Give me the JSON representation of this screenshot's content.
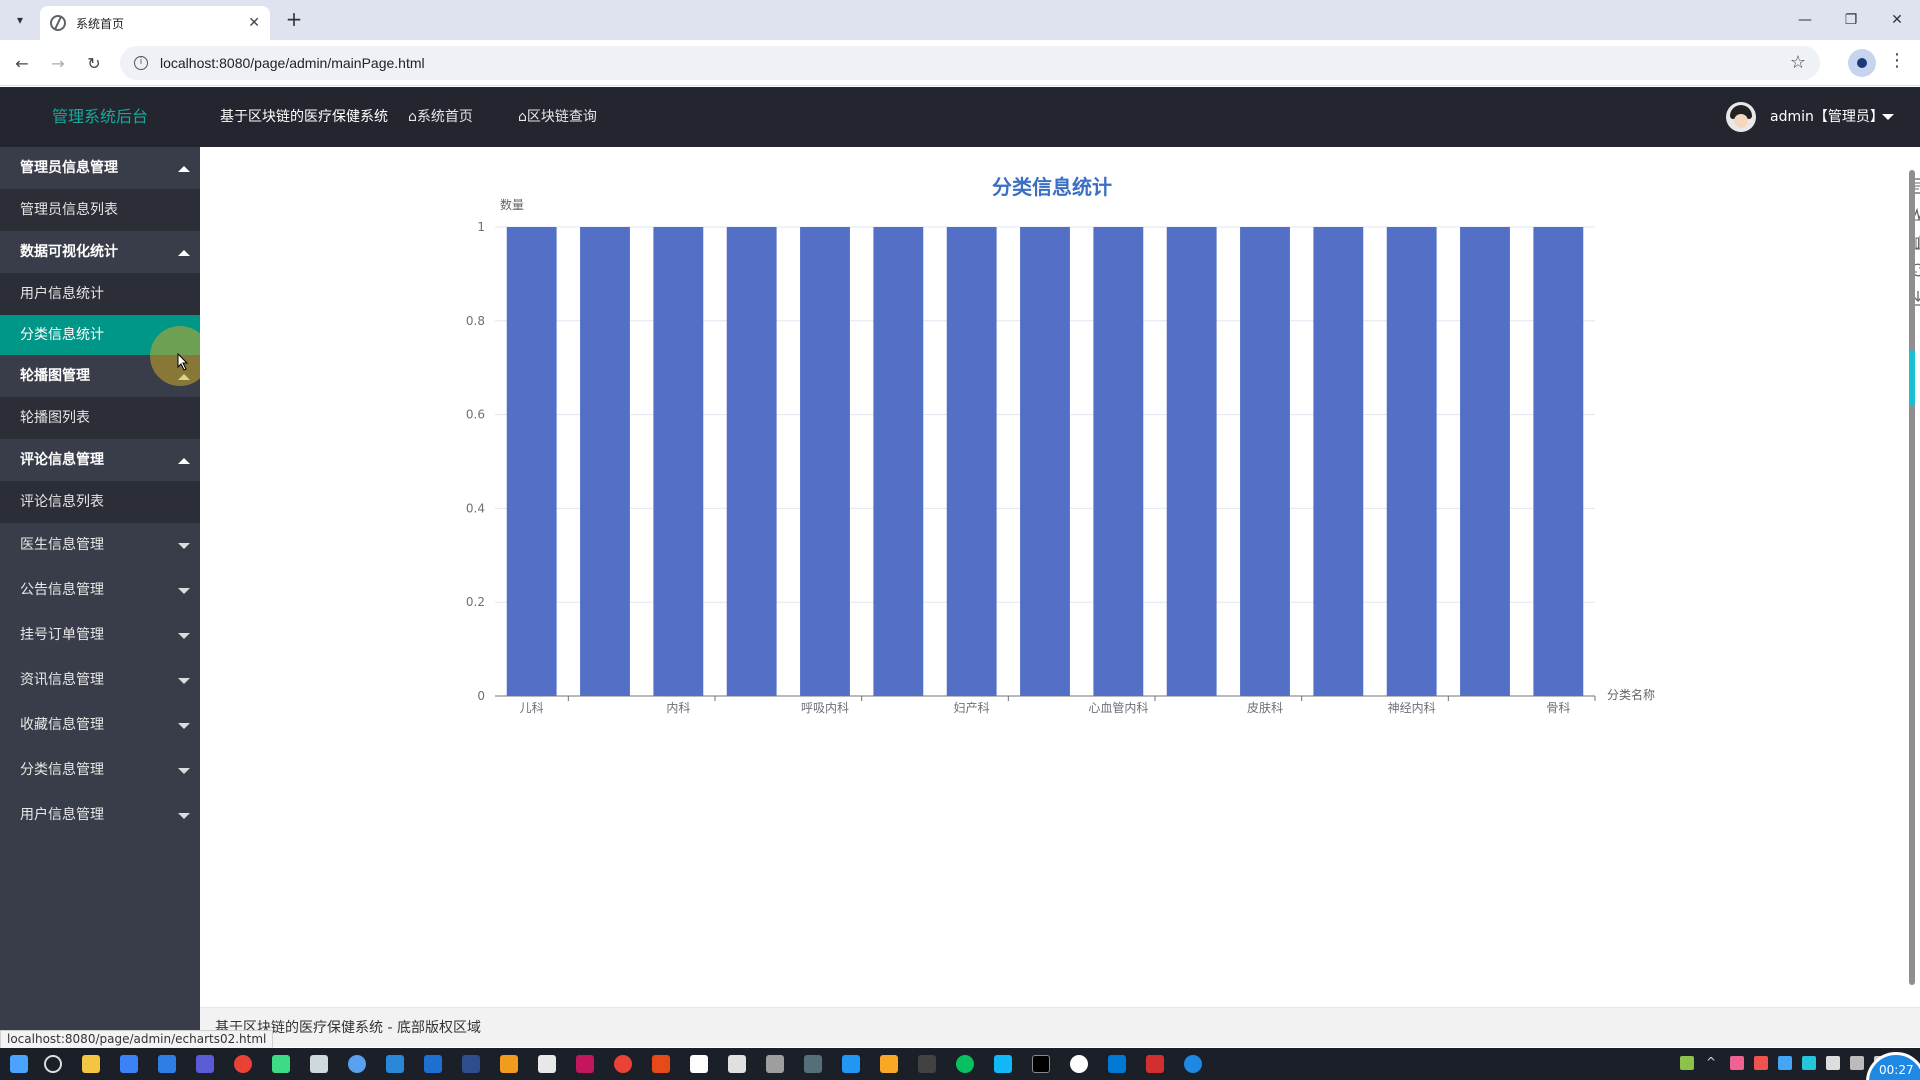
{
  "browser": {
    "tab_title": "系统首页",
    "url": "localhost:8080/page/admin/mainPage.html",
    "status_url": "localhost:8080/page/admin/echarts02.html"
  },
  "header": {
    "brand": "管理系统后台",
    "system_name": "基于区块链的医疗保健系统",
    "nav_home": "⌂系统首页",
    "nav_chain": "⌂区块链查询",
    "user_label": "admin【管理员】"
  },
  "sidebar": {
    "groups": [
      {
        "label": "管理员信息管理",
        "items": [
          "管理员信息列表"
        ]
      },
      {
        "label": "数据可视化统计",
        "items": [
          "用户信息统计",
          "分类信息统计"
        ]
      },
      {
        "label": "轮播图管理",
        "items": [
          "轮播图列表"
        ]
      },
      {
        "label": "评论信息管理",
        "items": [
          "评论信息列表"
        ]
      }
    ],
    "collapsed": [
      "医生信息管理",
      "公告信息管理",
      "挂号订单管理",
      "资讯信息管理",
      "收藏信息管理",
      "分类信息管理",
      "用户信息管理"
    ]
  },
  "chart_data": {
    "type": "bar",
    "title": "分类信息统计",
    "ylabel": "数量",
    "xlabel": "分类名称",
    "ylim": [
      0,
      1
    ],
    "yticks": [
      "0",
      "0.2",
      "0.4",
      "0.6",
      "0.8",
      "1"
    ],
    "categories": [
      "儿科",
      "",
      "内科",
      "",
      "呼吸内科",
      "",
      "妇产科",
      "",
      "心血管内科",
      "",
      "皮肤科",
      "",
      "神经内科",
      "",
      "骨科"
    ],
    "values": [
      1,
      1,
      1,
      1,
      1,
      1,
      1,
      1,
      1,
      1,
      1,
      1,
      1,
      1,
      1
    ],
    "bar_color": "#5470c6",
    "grid": true
  },
  "chart_tools": [
    "data-view-icon",
    "line-icon",
    "bar-icon",
    "restore-icon",
    "save-image-icon"
  ],
  "footer": {
    "text": "基于区块链的医疗保健系统 - 底部版权区域"
  },
  "taskbar": {
    "clock": "00:27"
  },
  "colors": {
    "header_bg": "#23262e",
    "sidebar_bg": "#393d49",
    "accent": "#009688",
    "brand": "#19a89c"
  }
}
